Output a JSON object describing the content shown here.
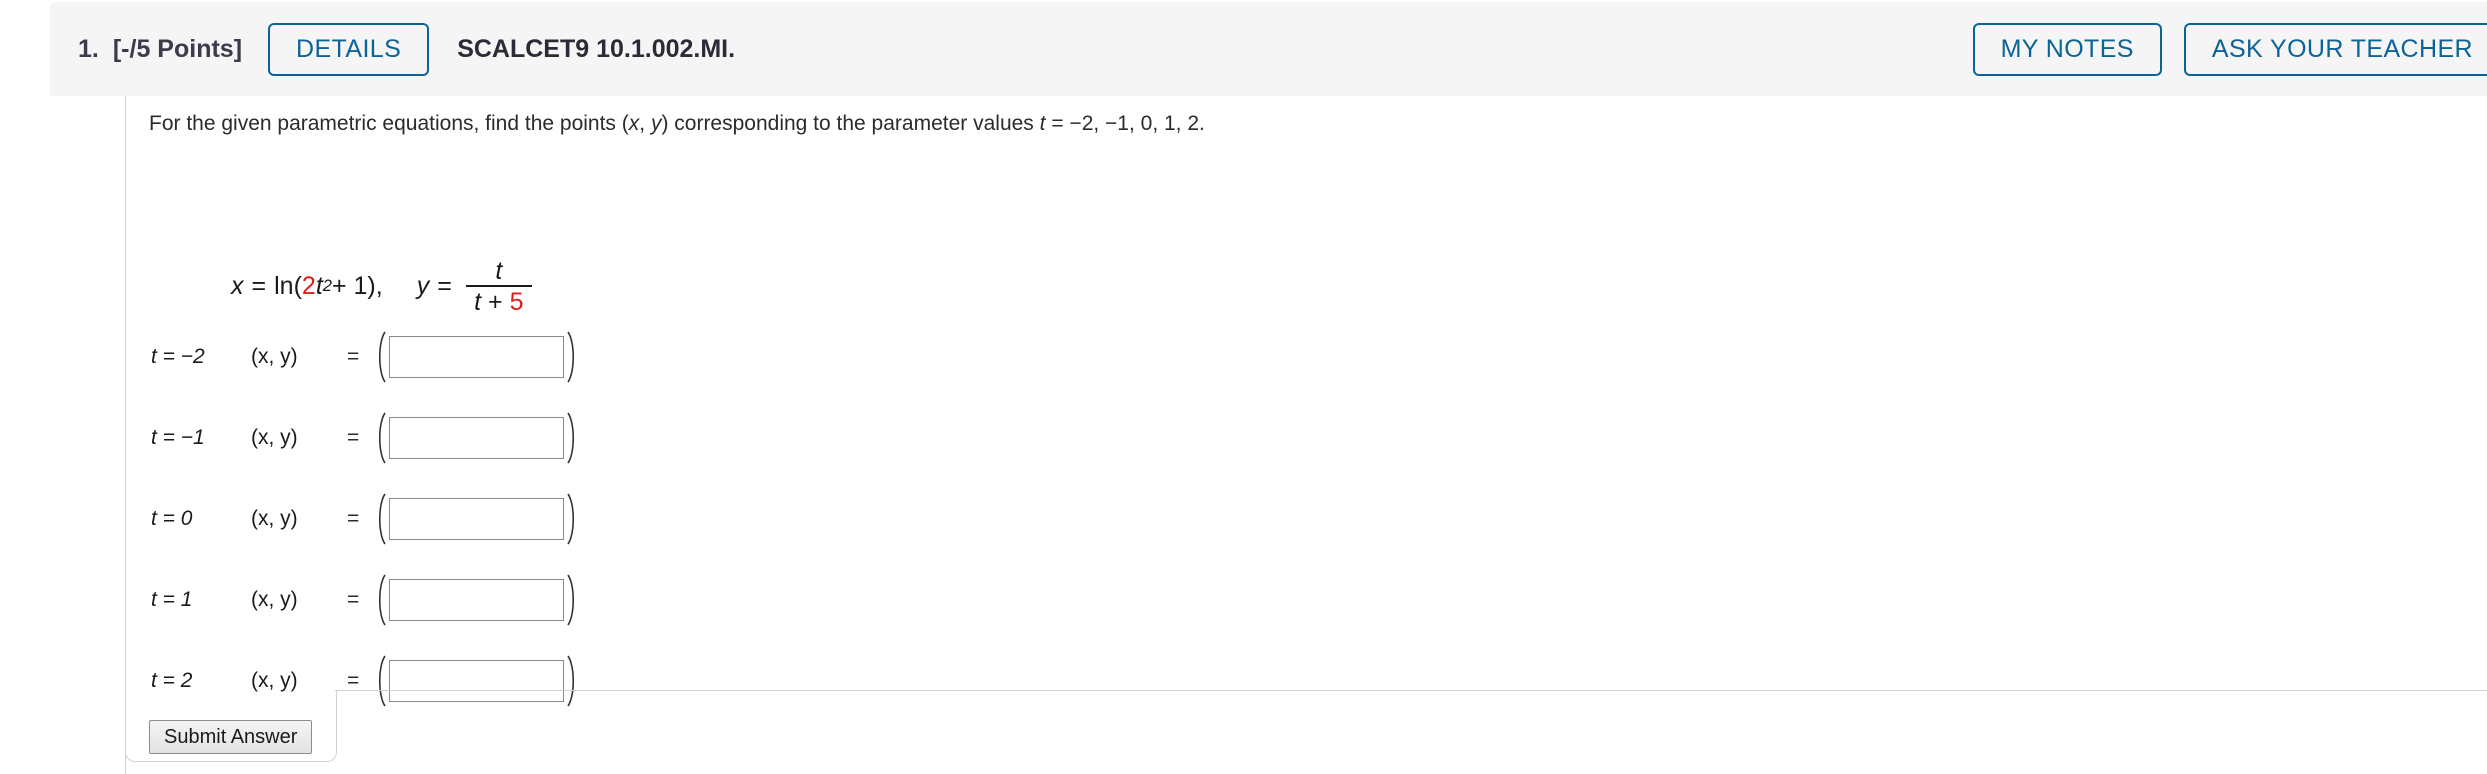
{
  "header": {
    "question_number": "1.",
    "points": "[-/5 Points]",
    "details_label": "DETAILS",
    "assignment_code": "SCALCET9 10.1.002.MI.",
    "my_notes_label": "MY NOTES",
    "ask_teacher_label": "ASK YOUR TEACHER",
    "accent_color": "#0b6497",
    "bar_background": "#f5f5f5"
  },
  "prompt": {
    "part1": "For the given parametric equations, find the points (",
    "var_x": "x",
    "comma": ", ",
    "var_y": "y",
    "part2": ") corresponding to the parameter values ",
    "var_t": "t",
    "part3": " = −2, −1, 0, 1, 2."
  },
  "equation": {
    "x_var": "x",
    "equals": "=",
    "ln_open": "ln(",
    "coefficient": "2",
    "t_var": "t",
    "exponent": "2",
    "plus_one": " + 1),",
    "y_var": "y",
    "fraction_numerator": "t",
    "fraction_denom_t": "t",
    "fraction_denom_plus": " + ",
    "fraction_denom_const": "5",
    "red_color": "#e01b1b"
  },
  "rows": [
    {
      "t_label_var": "t",
      "t_label_value": " = −2",
      "xy_label": "(x, y)",
      "equals": "=",
      "input_value": "",
      "placeholder": ""
    },
    {
      "t_label_var": "t",
      "t_label_value": " = −1",
      "xy_label": "(x, y)",
      "equals": "=",
      "input_value": "",
      "placeholder": ""
    },
    {
      "t_label_var": "t",
      "t_label_value": " = 0",
      "xy_label": "(x, y)",
      "equals": "=",
      "input_value": "",
      "placeholder": ""
    },
    {
      "t_label_var": "t",
      "t_label_value": " = 1",
      "xy_label": "(x, y)",
      "equals": "=",
      "input_value": "",
      "placeholder": ""
    },
    {
      "t_label_var": "t",
      "t_label_value": " = 2",
      "xy_label": "(x, y)",
      "equals": "=",
      "input_value": "",
      "placeholder": ""
    }
  ],
  "footer": {
    "submit_label": "Submit Answer"
  }
}
